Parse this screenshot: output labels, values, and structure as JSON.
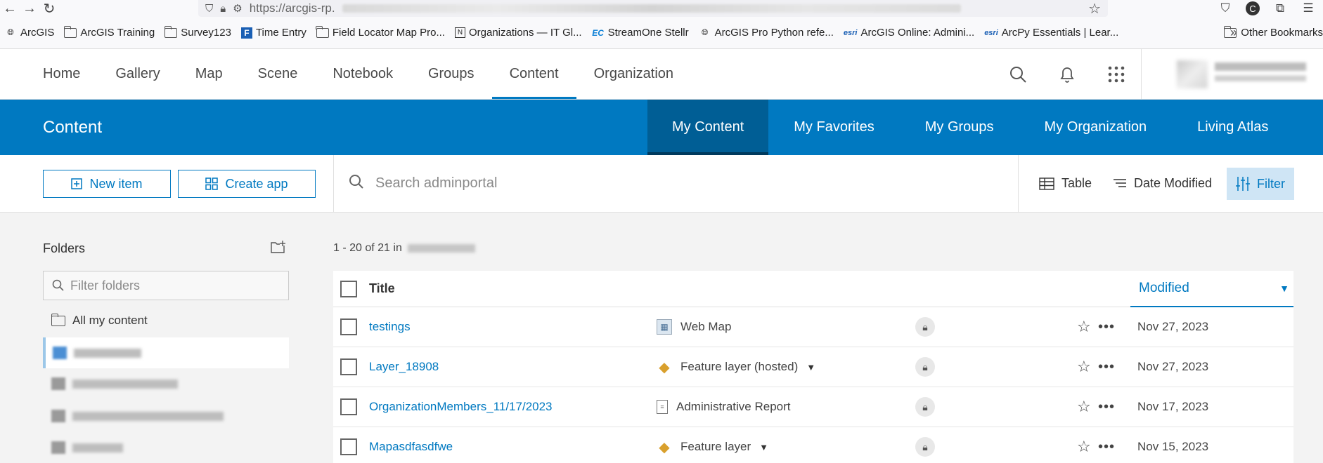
{
  "browser": {
    "url_prefix": "https://arcgis-rp.",
    "bookmarks": [
      {
        "label": "ArcGIS",
        "icon": "globe-icon"
      },
      {
        "label": "ArcGIS Training",
        "icon": "folder-icon"
      },
      {
        "label": "Survey123",
        "icon": "folder-icon"
      },
      {
        "label": "Time Entry",
        "icon": "f-logo-icon"
      },
      {
        "label": "Field Locator Map Pro...",
        "icon": "folder-icon"
      },
      {
        "label": "Organizations — IT Gl...",
        "icon": "n-logo-icon"
      },
      {
        "label": "StreamOne Stellr",
        "icon": "ec-logo-icon"
      },
      {
        "label": "ArcGIS Pro Python refe...",
        "icon": "globe-icon"
      },
      {
        "label": "ArcGIS Online: Admini...",
        "icon": "esri-logo-icon"
      },
      {
        "label": "ArcPy Essentials | Lear...",
        "icon": "esri-logo-icon"
      }
    ],
    "esri_text": "esri",
    "other_bookmarks": "Other Bookmarks"
  },
  "nav": {
    "items": [
      "Home",
      "Gallery",
      "Map",
      "Scene",
      "Notebook",
      "Groups",
      "Content",
      "Organization"
    ],
    "active": "Content"
  },
  "content_bar": {
    "title": "Content",
    "tabs": [
      "My Content",
      "My Favorites",
      "My Groups",
      "My Organization",
      "Living Atlas"
    ]
  },
  "toolbar": {
    "new_item": "New item",
    "create_app": "Create app",
    "search_placeholder": "Search adminportal",
    "table": "Table",
    "date_modified": "Date Modified",
    "filter": "Filter"
  },
  "folders": {
    "title": "Folders",
    "filter_placeholder": "Filter folders",
    "all_content": "All my content"
  },
  "results": {
    "count": "1 - 20 of 21 in"
  },
  "table": {
    "col_title": "Title",
    "col_modified": "Modified",
    "rows": [
      {
        "title": "testings",
        "type": "Web Map",
        "date": "Nov 27, 2023",
        "has_caret": false
      },
      {
        "title": "Layer_18908",
        "type": "Feature layer (hosted)",
        "date": "Nov 27, 2023",
        "has_caret": true
      },
      {
        "title": "OrganizationMembers_11/17/2023",
        "type": "Administrative Report",
        "date": "Nov 17, 2023",
        "has_caret": false
      },
      {
        "title": "Mapasdfasdfwe",
        "type": "Feature layer",
        "date": "Nov 15, 2023",
        "has_caret": true
      }
    ]
  },
  "colors": {
    "brand_blue": "#0079c1",
    "active_tab": "#005e95"
  }
}
